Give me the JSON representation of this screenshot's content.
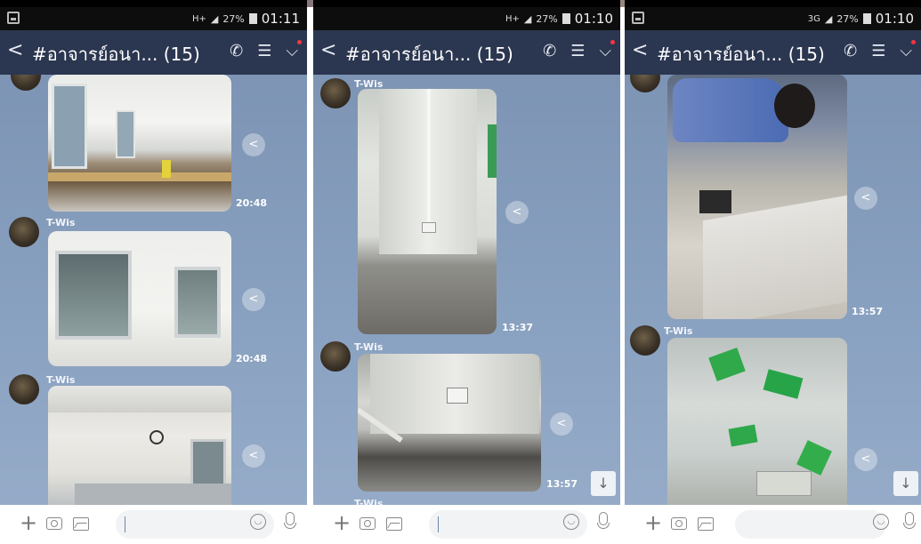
{
  "panels": [
    {
      "status": {
        "time": "01:11",
        "battery": "27%",
        "network": "H+"
      },
      "header": {
        "title": "#อาจารย์อนา... (15)"
      },
      "messages": [
        {
          "sender": "",
          "time": "20:48"
        },
        {
          "sender": "T-Wis",
          "time": "20:48"
        },
        {
          "sender": "T-Wis",
          "time": ""
        }
      ]
    },
    {
      "status": {
        "time": "01:10",
        "battery": "27%",
        "network": "H+"
      },
      "header": {
        "title": "#อาจารย์อนา... (15)"
      },
      "messages": [
        {
          "sender": "T-Wis",
          "time": "13:37"
        },
        {
          "sender": "T-Wis",
          "time": "13:57"
        },
        {
          "sender": "T-Wis",
          "time": ""
        }
      ]
    },
    {
      "status": {
        "time": "01:10",
        "battery": "27%",
        "network": "3G"
      },
      "header": {
        "title": "#อาจารย์อนา... (15)"
      },
      "messages": [
        {
          "sender": "",
          "time": "13:57"
        },
        {
          "sender": "T-Wis",
          "time": ""
        }
      ]
    }
  ],
  "icons": {
    "back": "chevron-left-icon",
    "call": "phone-icon",
    "notes": "notes-icon",
    "menu": "chevron-down-icon",
    "share": "share-icon",
    "scroll": "arrow-down-icon",
    "add": "plus-icon",
    "camera": "camera-icon",
    "gallery": "image-icon",
    "emoji": "emoji-icon",
    "mic": "microphone-icon"
  },
  "colors": {
    "header": "#2b3650",
    "chat_bg": "#8aa2c1",
    "unread_dot": "#ff3344"
  }
}
